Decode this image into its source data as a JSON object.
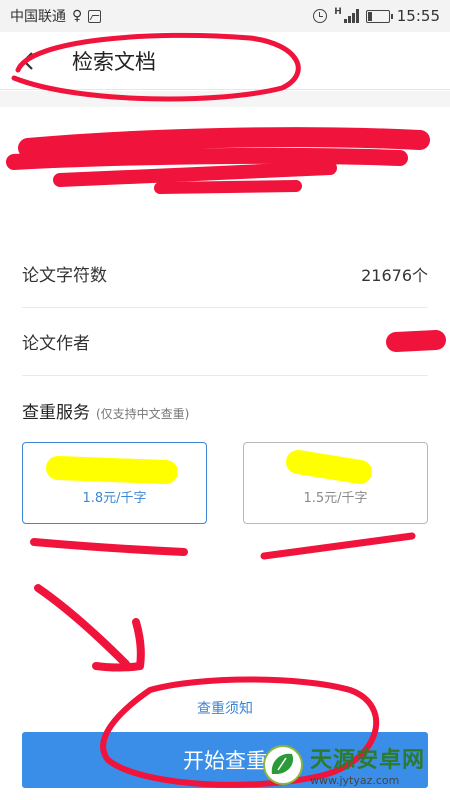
{
  "status_bar": {
    "carrier": "中国联通",
    "extra_glyph": "♀",
    "network": "H",
    "time": "15:55",
    "battery_level": 0.2
  },
  "header": {
    "title": "检索文档"
  },
  "info": {
    "word_count_label": "论文字符数",
    "word_count_value": "21676个",
    "author_label": "论文作者",
    "author_value": ""
  },
  "service": {
    "title": "查重服务",
    "note": "(仅支持中文查重)",
    "plans": [
      {
        "name": "",
        "price": "1.8元/千字",
        "selected": true
      },
      {
        "name": "",
        "price": "1.5元/千字",
        "selected": false
      }
    ]
  },
  "notice_link": "查重须知",
  "start_button_label": "开始查重",
  "watermark": {
    "name": "天源安卓网",
    "url": "www.jytyaz.com"
  },
  "colors": {
    "accent": "#3a8ee8",
    "link": "#3a86d4",
    "annotation_red": "#f0143c",
    "highlight_yellow": "#ffff00"
  }
}
